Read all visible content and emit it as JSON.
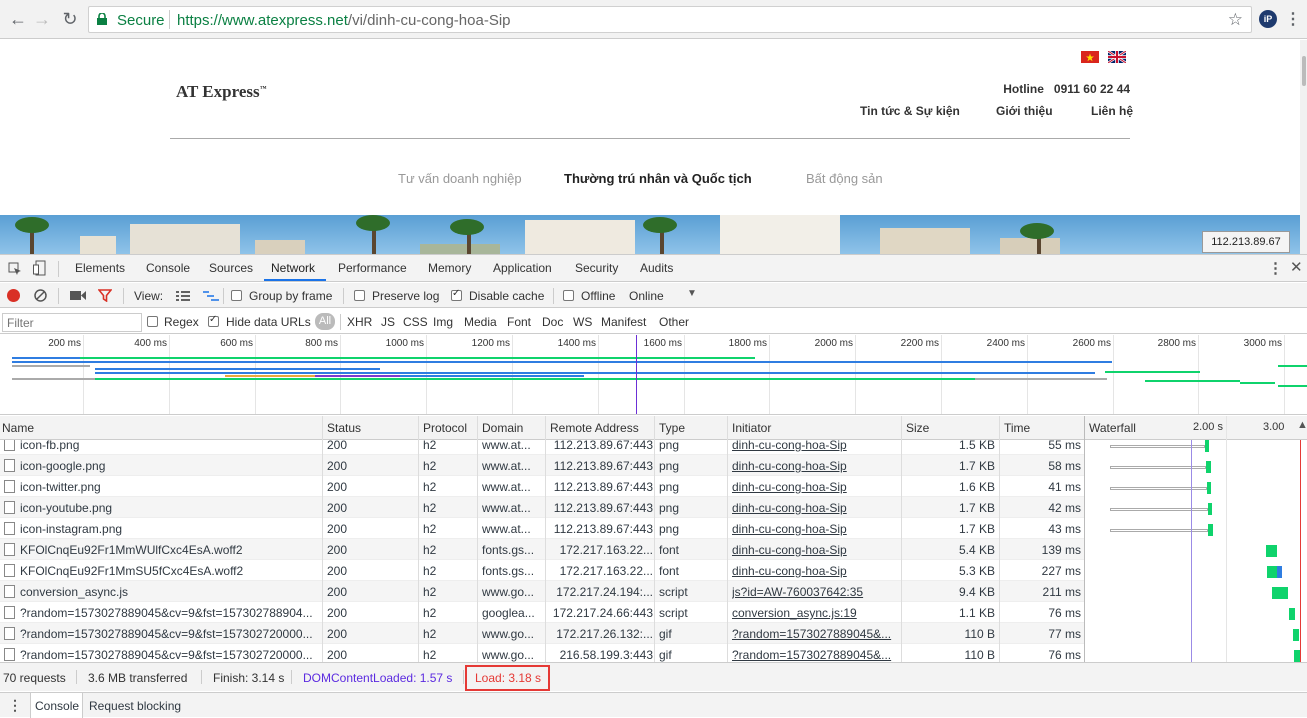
{
  "browser": {
    "secure_label": "Secure",
    "url_host": "https://www.atexpress.net",
    "url_path": "/vi/dinh-cu-cong-hoa-Sip",
    "ext_badge": "iP"
  },
  "page": {
    "logo": "AT Express",
    "logo_tm": "™",
    "hotline_label": "Hotline",
    "hotline_number": "0911 60 22 44",
    "nav": [
      "Tin tức & Sự kiện",
      "Giới thiệu",
      "Liên hệ"
    ],
    "categories": [
      "Tư vấn doanh nghiệp",
      "Thường trú nhân và Quốc tịch",
      "Bất động sản"
    ],
    "ip_badge": "112.213.89.67"
  },
  "devtools": {
    "tabs": [
      "Elements",
      "Console",
      "Sources",
      "Network",
      "Performance",
      "Memory",
      "Application",
      "Security",
      "Audits"
    ],
    "active_tab": "Network",
    "toolbar": {
      "view_label": "View:",
      "group_by_frame": "Group by frame",
      "preserve_log": "Preserve log",
      "disable_cache": "Disable cache",
      "offline": "Offline",
      "throttle": "Online"
    },
    "filter": {
      "placeholder": "Filter",
      "regex": "Regex",
      "hide_data_urls": "Hide data URLs",
      "all": "All",
      "types": [
        "XHR",
        "JS",
        "CSS",
        "Img",
        "Media",
        "Font",
        "Doc",
        "WS",
        "Manifest",
        "Other"
      ]
    },
    "overview_ticks": [
      "200 ms",
      "400 ms",
      "600 ms",
      "800 ms",
      "1000 ms",
      "1200 ms",
      "1400 ms",
      "1600 ms",
      "1800 ms",
      "2000 ms",
      "2200 ms",
      "2400 ms",
      "2600 ms",
      "2800 ms",
      "3000 ms"
    ],
    "columns": [
      "Name",
      "Status",
      "Protocol",
      "Domain",
      "Remote Address",
      "Type",
      "Initiator",
      "Size",
      "Time",
      "Waterfall"
    ],
    "waterfall_ticks": [
      "2.00 s",
      "3.00"
    ],
    "rows": [
      {
        "name": "icon-fb.png",
        "status": "200",
        "protocol": "h2",
        "domain": "www.at...",
        "remote": "112.213.89.67:443",
        "type": "png",
        "initiator": "dinh-cu-cong-hoa-Sip",
        "size": "1.5 KB",
        "time": "55 ms"
      },
      {
        "name": "icon-google.png",
        "status": "200",
        "protocol": "h2",
        "domain": "www.at...",
        "remote": "112.213.89.67:443",
        "type": "png",
        "initiator": "dinh-cu-cong-hoa-Sip",
        "size": "1.7 KB",
        "time": "58 ms"
      },
      {
        "name": "icon-twitter.png",
        "status": "200",
        "protocol": "h2",
        "domain": "www.at...",
        "remote": "112.213.89.67:443",
        "type": "png",
        "initiator": "dinh-cu-cong-hoa-Sip",
        "size": "1.6 KB",
        "time": "41 ms"
      },
      {
        "name": "icon-youtube.png",
        "status": "200",
        "protocol": "h2",
        "domain": "www.at...",
        "remote": "112.213.89.67:443",
        "type": "png",
        "initiator": "dinh-cu-cong-hoa-Sip",
        "size": "1.7 KB",
        "time": "42 ms"
      },
      {
        "name": "icon-instagram.png",
        "status": "200",
        "protocol": "h2",
        "domain": "www.at...",
        "remote": "112.213.89.67:443",
        "type": "png",
        "initiator": "dinh-cu-cong-hoa-Sip",
        "size": "1.7 KB",
        "time": "43 ms"
      },
      {
        "name": "KFOlCnqEu92Fr1MmWUlfCxc4EsA.woff2",
        "status": "200",
        "protocol": "h2",
        "domain": "fonts.gs...",
        "remote": "172.217.163.22...",
        "type": "font",
        "initiator": "dinh-cu-cong-hoa-Sip",
        "size": "5.4 KB",
        "time": "139 ms"
      },
      {
        "name": "KFOlCnqEu92Fr1MmSU5fCxc4EsA.woff2",
        "status": "200",
        "protocol": "h2",
        "domain": "fonts.gs...",
        "remote": "172.217.163.22...",
        "type": "font",
        "initiator": "dinh-cu-cong-hoa-Sip",
        "size": "5.3 KB",
        "time": "227 ms"
      },
      {
        "name": "conversion_async.js",
        "status": "200",
        "protocol": "h2",
        "domain": "www.go...",
        "remote": "172.217.24.194:...",
        "type": "script",
        "initiator": "js?id=AW-760037642:35",
        "size": "9.4 KB",
        "time": "211 ms"
      },
      {
        "name": "?random=1573027889045&cv=9&fst=157302788904...",
        "status": "200",
        "protocol": "h2",
        "domain": "googlea...",
        "remote": "172.217.24.66:443",
        "type": "script",
        "initiator": "conversion_async.js:19",
        "size": "1.1 KB",
        "time": "76 ms"
      },
      {
        "name": "?random=1573027889045&cv=9&fst=157302720000...",
        "status": "200",
        "protocol": "h2",
        "domain": "www.go...",
        "remote": "172.217.26.132:...",
        "type": "gif",
        "initiator": "?random=1573027889045&...",
        "size": "110 B",
        "time": "77 ms"
      },
      {
        "name": "?random=1573027889045&cv=9&fst=157302720000...",
        "status": "200",
        "protocol": "h2",
        "domain": "www.go...",
        "remote": "216.58.199.3:443",
        "type": "gif",
        "initiator": "?random=1573027889045&...",
        "size": "110 B",
        "time": "76 ms"
      }
    ],
    "status": {
      "requests": "70 requests",
      "transferred": "3.6 MB transferred",
      "finish": "Finish: 3.14 s",
      "domcontentloaded": "DOMContentLoaded: 1.57 s",
      "load": "Load: 3.18 s"
    },
    "drawer_tabs": [
      "Console",
      "Request blocking"
    ],
    "colors": {
      "accent": "#1a73e8",
      "dcl": "#5b2ae0",
      "load": "#e53935",
      "bar_green": "#0fd36c",
      "bar_blue": "#2f7de1"
    }
  }
}
